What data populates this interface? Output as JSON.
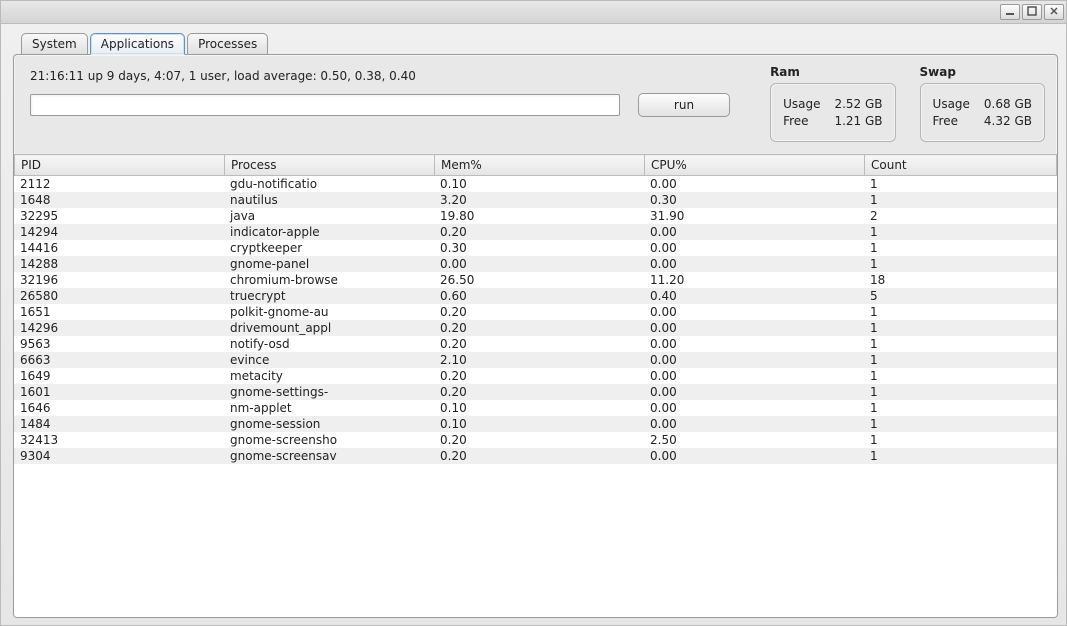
{
  "window": {
    "minimize_icon": "minimize-icon",
    "maximize_icon": "maximize-icon",
    "close_icon": "close-icon"
  },
  "tabs": {
    "system": "System",
    "applications": "Applications",
    "processes": "Processes",
    "active": "applications"
  },
  "status_line": "21:16:11 up 9 days,  4:07,  1 user,  load average: 0.50, 0.38, 0.40",
  "command": {
    "value": "",
    "placeholder": ""
  },
  "run_button": "run",
  "ram": {
    "label": "Ram",
    "usage_label": "Usage",
    "usage_value": "2.52 GB",
    "free_label": "Free",
    "free_value": "1.21 GB"
  },
  "swap": {
    "label": "Swap",
    "usage_label": "Usage",
    "usage_value": "0.68 GB",
    "free_label": "Free",
    "free_value": "4.32 GB"
  },
  "columns": {
    "pid": "PID",
    "process": "Process",
    "mem": "Mem%",
    "cpu": "CPU%",
    "count": "Count"
  },
  "rows": [
    {
      "pid": "2112",
      "process": "gdu-notificatio",
      "mem": "0.10",
      "cpu": "0.00",
      "count": "1"
    },
    {
      "pid": "1648",
      "process": "nautilus",
      "mem": "3.20",
      "cpu": "0.30",
      "count": "1"
    },
    {
      "pid": "32295",
      "process": "java",
      "mem": "19.80",
      "cpu": "31.90",
      "count": "2"
    },
    {
      "pid": "14294",
      "process": "indicator-apple",
      "mem": "0.20",
      "cpu": "0.00",
      "count": "1"
    },
    {
      "pid": "14416",
      "process": "cryptkeeper",
      "mem": "0.30",
      "cpu": "0.00",
      "count": "1"
    },
    {
      "pid": "14288",
      "process": "gnome-panel",
      "mem": "0.00",
      "cpu": "0.00",
      "count": "1"
    },
    {
      "pid": "32196",
      "process": "chromium-browse",
      "mem": "26.50",
      "cpu": "11.20",
      "count": "18"
    },
    {
      "pid": "26580",
      "process": "truecrypt",
      "mem": "0.60",
      "cpu": "0.40",
      "count": "5"
    },
    {
      "pid": "1651",
      "process": "polkit-gnome-au",
      "mem": "0.20",
      "cpu": "0.00",
      "count": "1"
    },
    {
      "pid": "14296",
      "process": "drivemount_appl",
      "mem": "0.20",
      "cpu": "0.00",
      "count": "1"
    },
    {
      "pid": "9563",
      "process": "notify-osd",
      "mem": "0.20",
      "cpu": "0.00",
      "count": "1"
    },
    {
      "pid": "6663",
      "process": "evince",
      "mem": "2.10",
      "cpu": "0.00",
      "count": "1"
    },
    {
      "pid": "1649",
      "process": "metacity",
      "mem": "0.20",
      "cpu": "0.00",
      "count": "1"
    },
    {
      "pid": "1601",
      "process": "gnome-settings-",
      "mem": "0.20",
      "cpu": "0.00",
      "count": "1"
    },
    {
      "pid": "1646",
      "process": "nm-applet",
      "mem": "0.10",
      "cpu": "0.00",
      "count": "1"
    },
    {
      "pid": "1484",
      "process": "gnome-session",
      "mem": "0.10",
      "cpu": "0.00",
      "count": "1"
    },
    {
      "pid": "32413",
      "process": "gnome-screensho",
      "mem": "0.20",
      "cpu": "2.50",
      "count": "1"
    },
    {
      "pid": "9304",
      "process": "gnome-screensav",
      "mem": "0.20",
      "cpu": "0.00",
      "count": "1"
    }
  ]
}
